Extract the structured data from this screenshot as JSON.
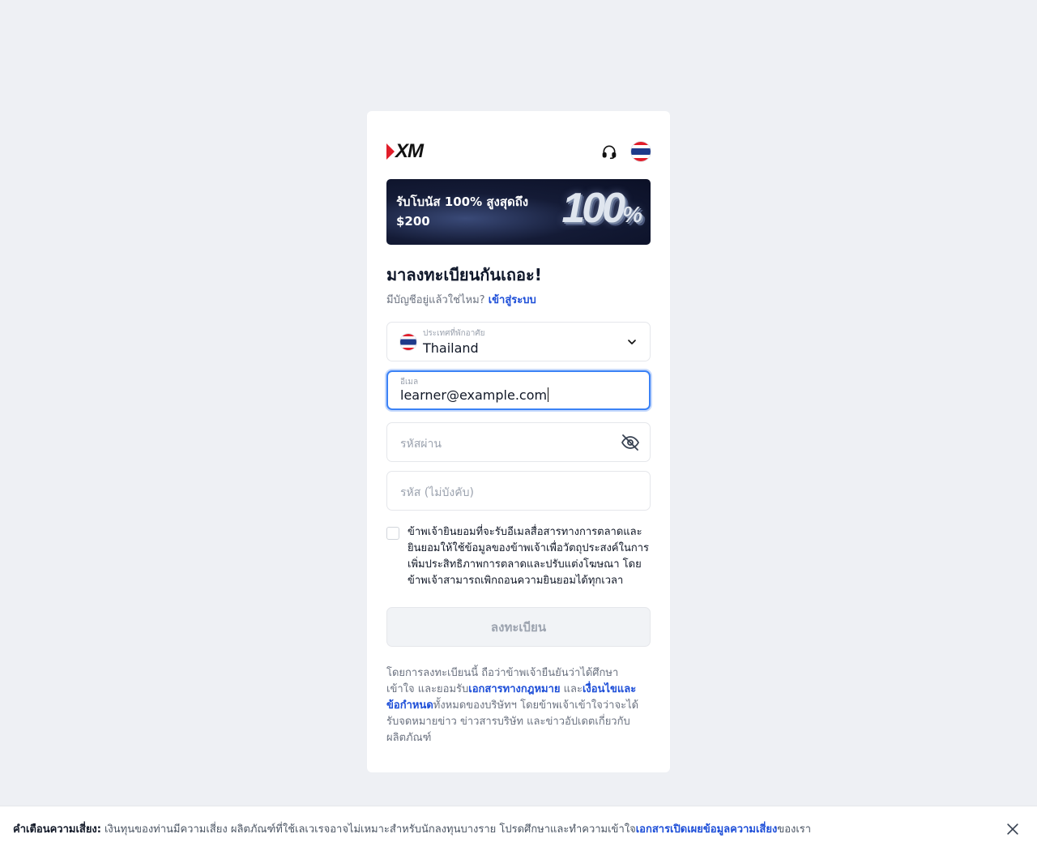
{
  "brand": {
    "logo_text": "XM",
    "accent": "#e11d2a",
    "link_color": "#1d4ed8"
  },
  "header": {
    "support_icon": "headset-icon",
    "language_flag": "thailand-flag-icon"
  },
  "banner": {
    "line1": "รับโบนัส 100% สูงสุดถึง",
    "line2": "$200",
    "big_number": "100",
    "big_percent": "%"
  },
  "form": {
    "title": "มาลงทะเบียนกันเถอะ!",
    "subtitle": "มีบัญชีอยู่แล้วใช่ไหม?",
    "login_link": "เข้าสู่ระบบ",
    "country": {
      "label": "ประเทศที่พักอาศัย",
      "value": "Thailand"
    },
    "email": {
      "label": "อีเมล",
      "value": "learner@example.com"
    },
    "password": {
      "placeholder": "รหัสผ่าน"
    },
    "code": {
      "placeholder": "รหัส (ไม่บังคับ)"
    },
    "consent": "ข้าพเจ้ายินยอมที่จะรับอีเมลสื่อสารทางการตลาดและยินยอมให้ใช้ข้อมูลของข้าพเจ้าเพื่อวัตถุประสงค์ในการเพิ่มประสิทธิภาพการตลาดและปรับแต่งโฆษณา โดยข้าพเจ้าสามารถเพิกถอนความยินยอมได้ทุกเวลา",
    "consent_checked": false,
    "submit_label": "ลงทะเบียน"
  },
  "legal": {
    "text1": "โดยการลงทะเบียนนี้ ถือว่าข้าพเจ้ายืนยันว่าได้ศึกษา เข้าใจ และยอมรับ",
    "link1": "เอกสารทางกฎหมาย",
    "and": " และ",
    "link2": "เงื่อนไขและข้อกำหนด",
    "text2": "ทั้งหมดของบริษัทฯ โดยข้าพเจ้าเข้าใจว่าจะได้รับจดหมายข่าว ข่าวสารบริษัท และข่าวอัปเดตเกี่ยวกับผลิตภัณฑ์"
  },
  "risk_bar": {
    "label": "คำเตือนความเสี่ยง:",
    "text": "เงินทุนของท่านมีความเสี่ยง ผลิตภัณฑ์ที่ใช้เลเวเรจอาจไม่เหมาะสำหรับนักลงทุนบางราย โปรดศึกษาและทำความเข้าใจ",
    "link": "เอกสารเปิดเผยข้อมูลความเสี่ยง",
    "suffix": "ของเรา"
  }
}
